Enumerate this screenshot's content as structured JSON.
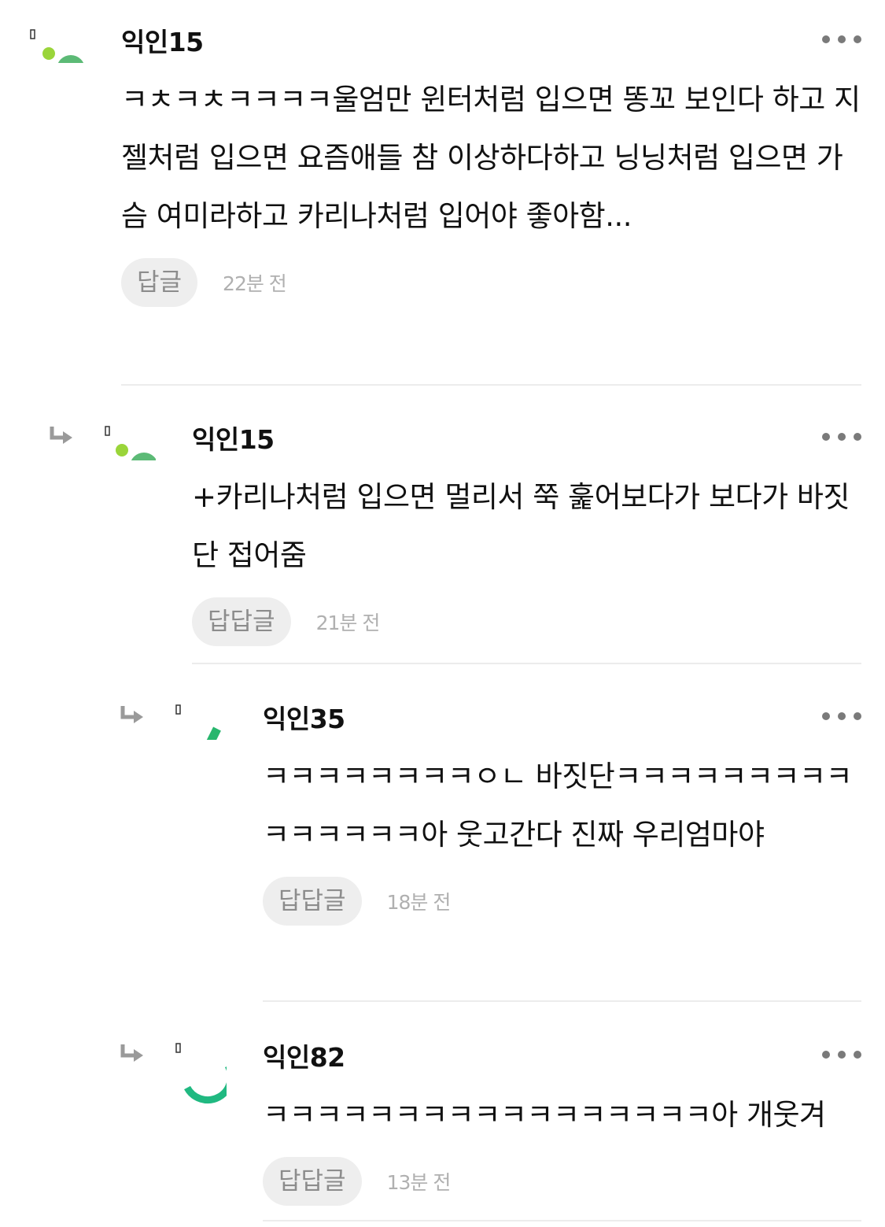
{
  "comments": [
    {
      "author": "익인15",
      "text": "ㅋㅊㅋㅊㅋㅋㅋㅋ울엄만 윈터처럼 입으면 똥꼬 보인다 하고 지젤처럼 입으면 요즘애들 참 이상하다하고 닝닝처럼 입으면 가슴 여미라하고 카리나처럼 입어야 좋아함...",
      "reply_label": "답글",
      "time": "22분 전"
    },
    {
      "author": "익인15",
      "text": "+카리나처럼 입으면 멀리서 쭉 훑어보다가 보다가 바짓단 접어줌",
      "reply_label": "답답글",
      "time": "21분 전"
    },
    {
      "author": "익인35",
      "text": "ㅋㅋㅋㅋㅋㅋㅋㅋㅇㄴ 바짓단ㅋㅋㅋㅋㅋㅋㅋㅋㅋㅋㅋㅋㅋㅋㅋ아 웃고간다 진짜 우리엄마야",
      "reply_label": "답답글",
      "time": "18분 전"
    },
    {
      "author": "익인82",
      "text": "ㅋㅋㅋㅋㅋㅋㅋㅋㅋㅋㅋㅋㅋㅋㅋㅋㅋ아 개웃겨",
      "reply_label": "답답글",
      "time": "13분 전"
    }
  ],
  "colors": {
    "avatar_green": "#5cba76",
    "avatar_light_green": "#9ad53a",
    "avatar_teal": "#20b981",
    "reply_button_bg": "#eeeeee",
    "time_text": "#b0b0b0",
    "divider": "#ececec"
  },
  "icons": {
    "reply_arrow": "reply-arrow-icon",
    "more": "more-dots-icon"
  }
}
